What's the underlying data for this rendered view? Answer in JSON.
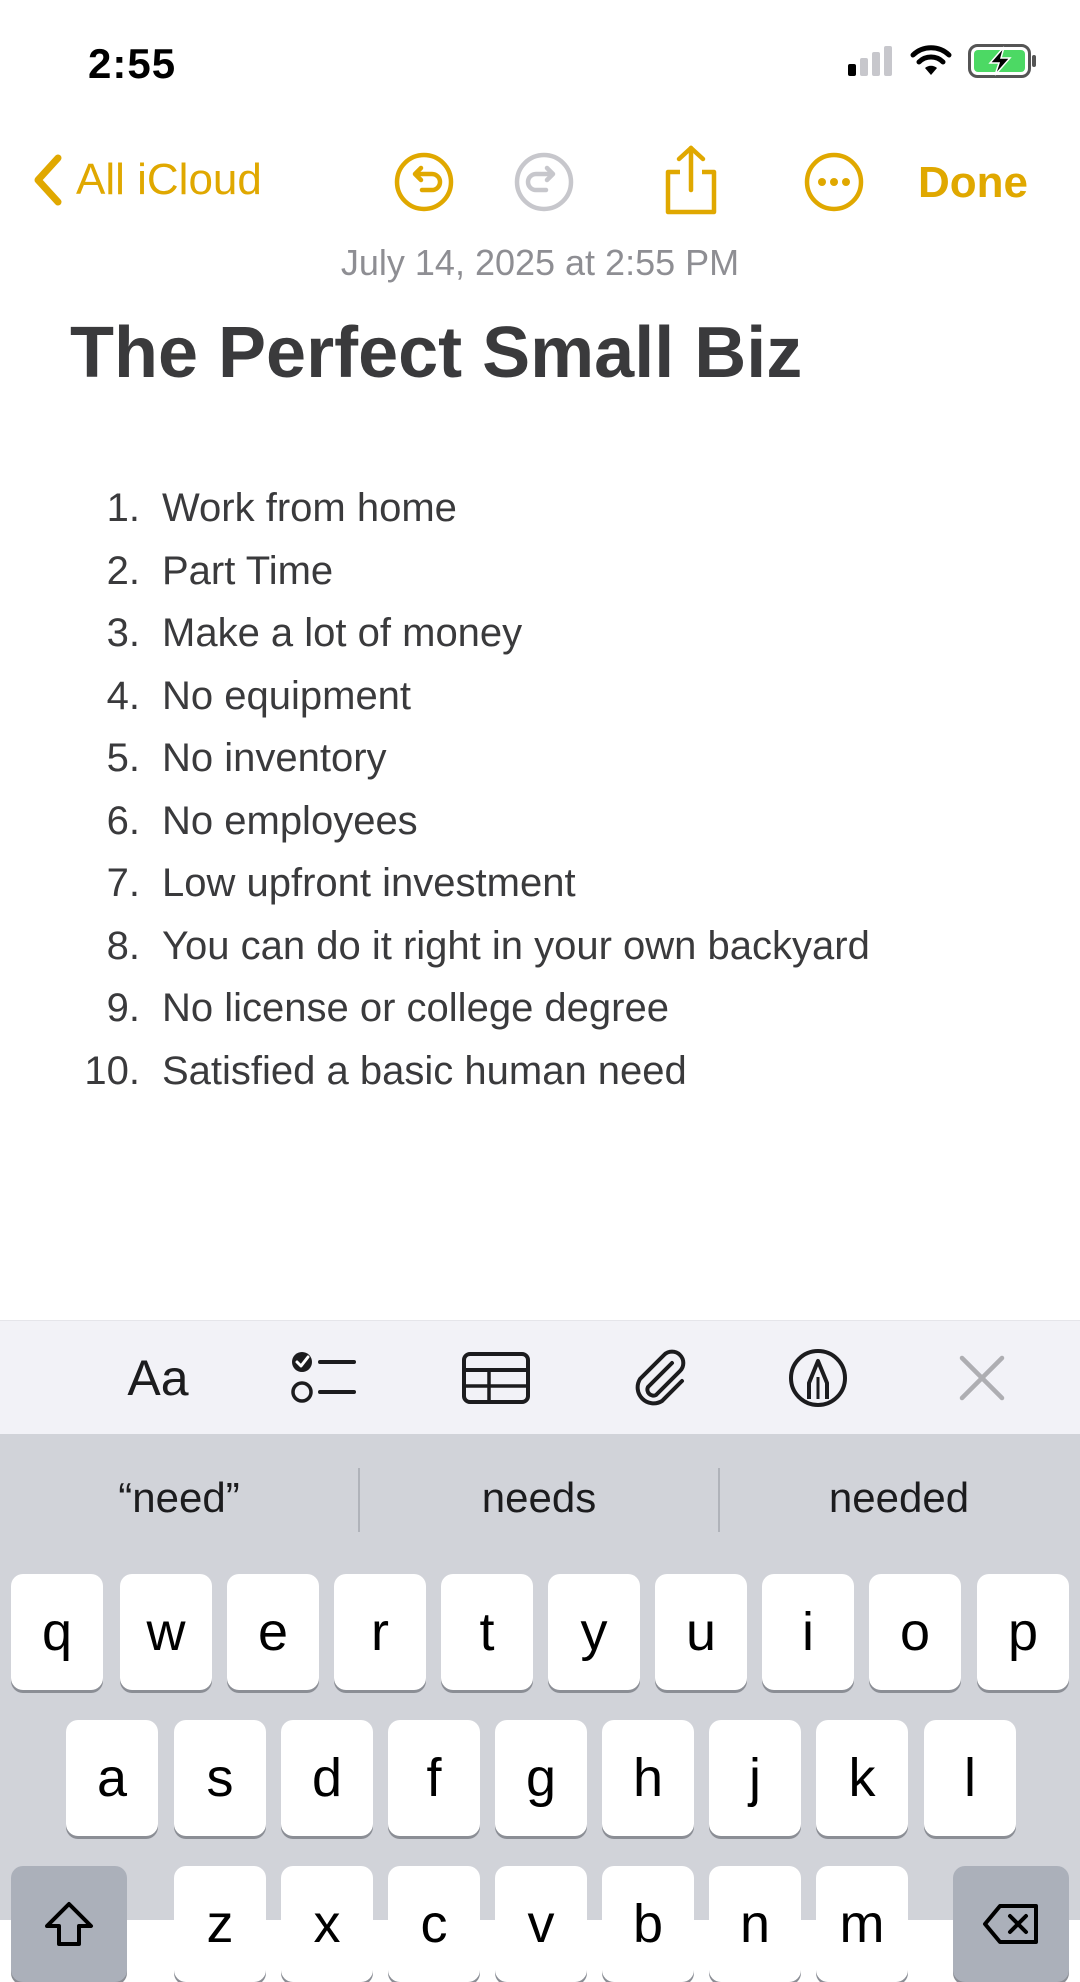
{
  "status_bar": {
    "time": "2:55"
  },
  "nav": {
    "back_label": "All iCloud",
    "done_label": "Done",
    "accent_color": "#e0a800"
  },
  "note": {
    "date": "July 14, 2025 at 2:55 PM",
    "title": "The Perfect Small Biz",
    "items": [
      {
        "num": "1.",
        "text": "Work from home"
      },
      {
        "num": "2.",
        "text": "Part Time"
      },
      {
        "num": "3.",
        "text": "Make a lot of money"
      },
      {
        "num": "4.",
        "text": "No equipment"
      },
      {
        "num": "5.",
        "text": "No inventory"
      },
      {
        "num": "6.",
        "text": "No employees"
      },
      {
        "num": "7.",
        "text": "Low upfront investment"
      },
      {
        "num": "8.",
        "text": "You can do it right in your own backyard"
      },
      {
        "num": "9.",
        "text": "No license or college degree"
      },
      {
        "num": "10.",
        "text": "Satisfied a basic human need"
      }
    ]
  },
  "toolbar": {
    "format_label": "Aa"
  },
  "keyboard": {
    "suggestions": [
      "“need”",
      "needs",
      "needed"
    ],
    "row1": [
      "q",
      "w",
      "e",
      "r",
      "t",
      "y",
      "u",
      "i",
      "o",
      "p"
    ],
    "row2": [
      "a",
      "s",
      "d",
      "f",
      "g",
      "h",
      "j",
      "k",
      "l"
    ],
    "row3": [
      "z",
      "x",
      "c",
      "v",
      "b",
      "n",
      "m"
    ]
  }
}
